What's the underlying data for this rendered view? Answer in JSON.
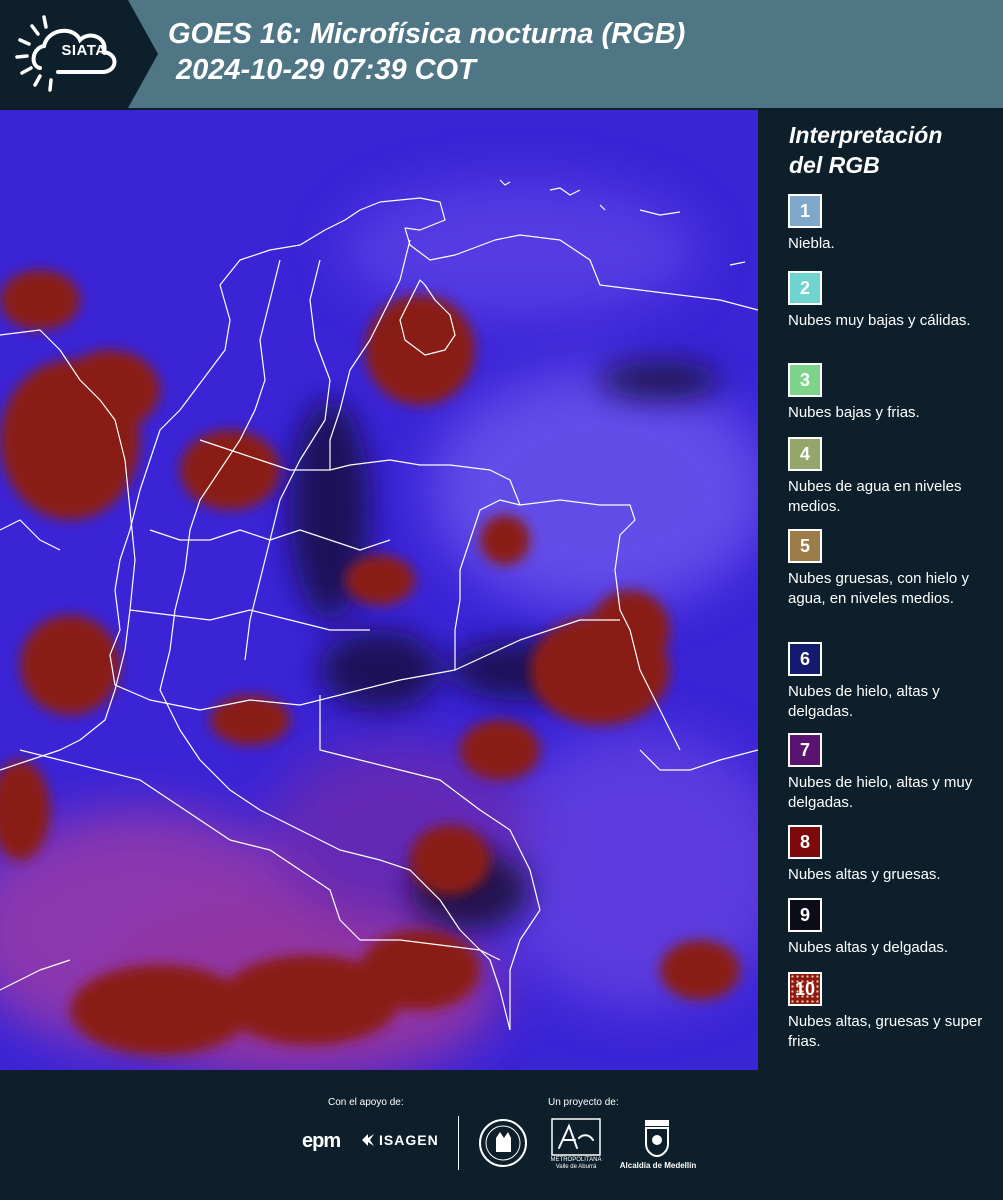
{
  "header": {
    "brand": "SIATA",
    "title_line1": "GOES 16: Microfísica nocturna (RGB)",
    "title_line2": "2024-10-29 07:39 COT",
    "background_color": "#4e7685"
  },
  "map": {
    "product": "satellite-rgb-night-microphysics",
    "background_color": "#3a24d6",
    "cloud_color": "#8a1a14",
    "border_color": "#ffffff"
  },
  "legend": {
    "heading_line1": "Interpretación",
    "heading_line2": "del RGB",
    "items": [
      {
        "number": "1",
        "color": "#7fa7c9",
        "label": "Niebla."
      },
      {
        "number": "2",
        "color": "#6fd3cf",
        "label": "Nubes muy bajas y cálidas."
      },
      {
        "number": "3",
        "color": "#7ed38a",
        "label": "Nubes bajas y frias."
      },
      {
        "number": "4",
        "color": "#94a66a",
        "label": "Nubes de agua en niveles medios."
      },
      {
        "number": "5",
        "color": "#9c7c48",
        "label": "Nubes gruesas, con hielo y agua, en niveles medios."
      },
      {
        "number": "6",
        "color": "#141a6e",
        "label": "Nubes de hielo, altas y delgadas."
      },
      {
        "number": "7",
        "color": "#5a1470",
        "label": "Nubes de hielo, altas y muy delgadas."
      },
      {
        "number": "8",
        "color": "#7d0a0a",
        "label": "Nubes altas y gruesas."
      },
      {
        "number": "9",
        "color": "#0c0c18",
        "label": "Nubes altas y delgadas."
      },
      {
        "number": "10",
        "color": "#8a1a14",
        "label": "Nubes altas, gruesas y super frias."
      }
    ]
  },
  "footer": {
    "support_label": "Con el apoyo de:",
    "project_label": "Un proyecto de:",
    "epm": "epm",
    "isagen": "ISAGEN",
    "area_caption_1": "METROPOLITANA",
    "area_caption_2": "Valle de Aburrá",
    "alcaldia": "Alcaldía de Medellín"
  }
}
